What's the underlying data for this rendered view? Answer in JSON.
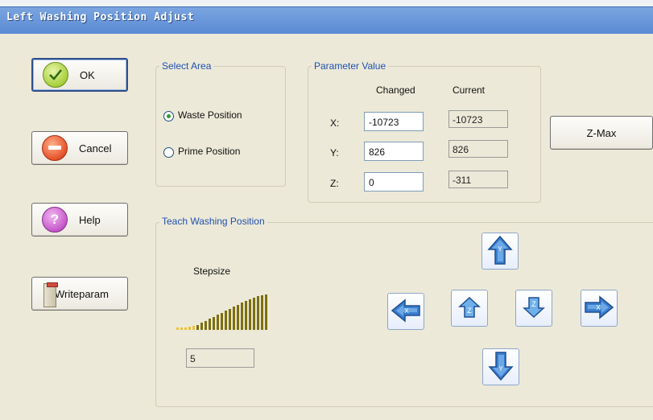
{
  "window": {
    "title": "Left Washing Position Adjust"
  },
  "buttons": {
    "ok": "OK",
    "cancel": "Cancel",
    "help": "Help",
    "writeparam": "Writeparam",
    "zmax": "Z-Max"
  },
  "select_area": {
    "title": "Select Area",
    "options": [
      {
        "label": "Waste Position",
        "selected": true
      },
      {
        "label": "Prime Position",
        "selected": false
      }
    ]
  },
  "parameter": {
    "title": "Parameter Value",
    "col_changed": "Changed",
    "col_current": "Current",
    "rows": [
      {
        "axis": "X:",
        "changed": "-10723",
        "current": "-10723"
      },
      {
        "axis": "Y:",
        "changed": "826",
        "current": "826"
      },
      {
        "axis": "Z:",
        "changed": "0",
        "current": "-311"
      }
    ]
  },
  "teach": {
    "title": "Teach Washing Position",
    "stepsize_label": "Stepsize",
    "stepsize_value": "5",
    "icons": [
      "arrow-up-y-icon",
      "arrow-left-x-icon",
      "arrow-z-up-icon",
      "arrow-z-down-icon",
      "arrow-right-x-icon",
      "arrow-down-y-icon"
    ]
  },
  "colors": {
    "title_bar": "#5b8ad4",
    "dialog_bg": "#ece9d8",
    "group_label": "#2050b0",
    "stepsize_bars": "#7c6f10",
    "arrow_blue": "#3a7fd0"
  }
}
